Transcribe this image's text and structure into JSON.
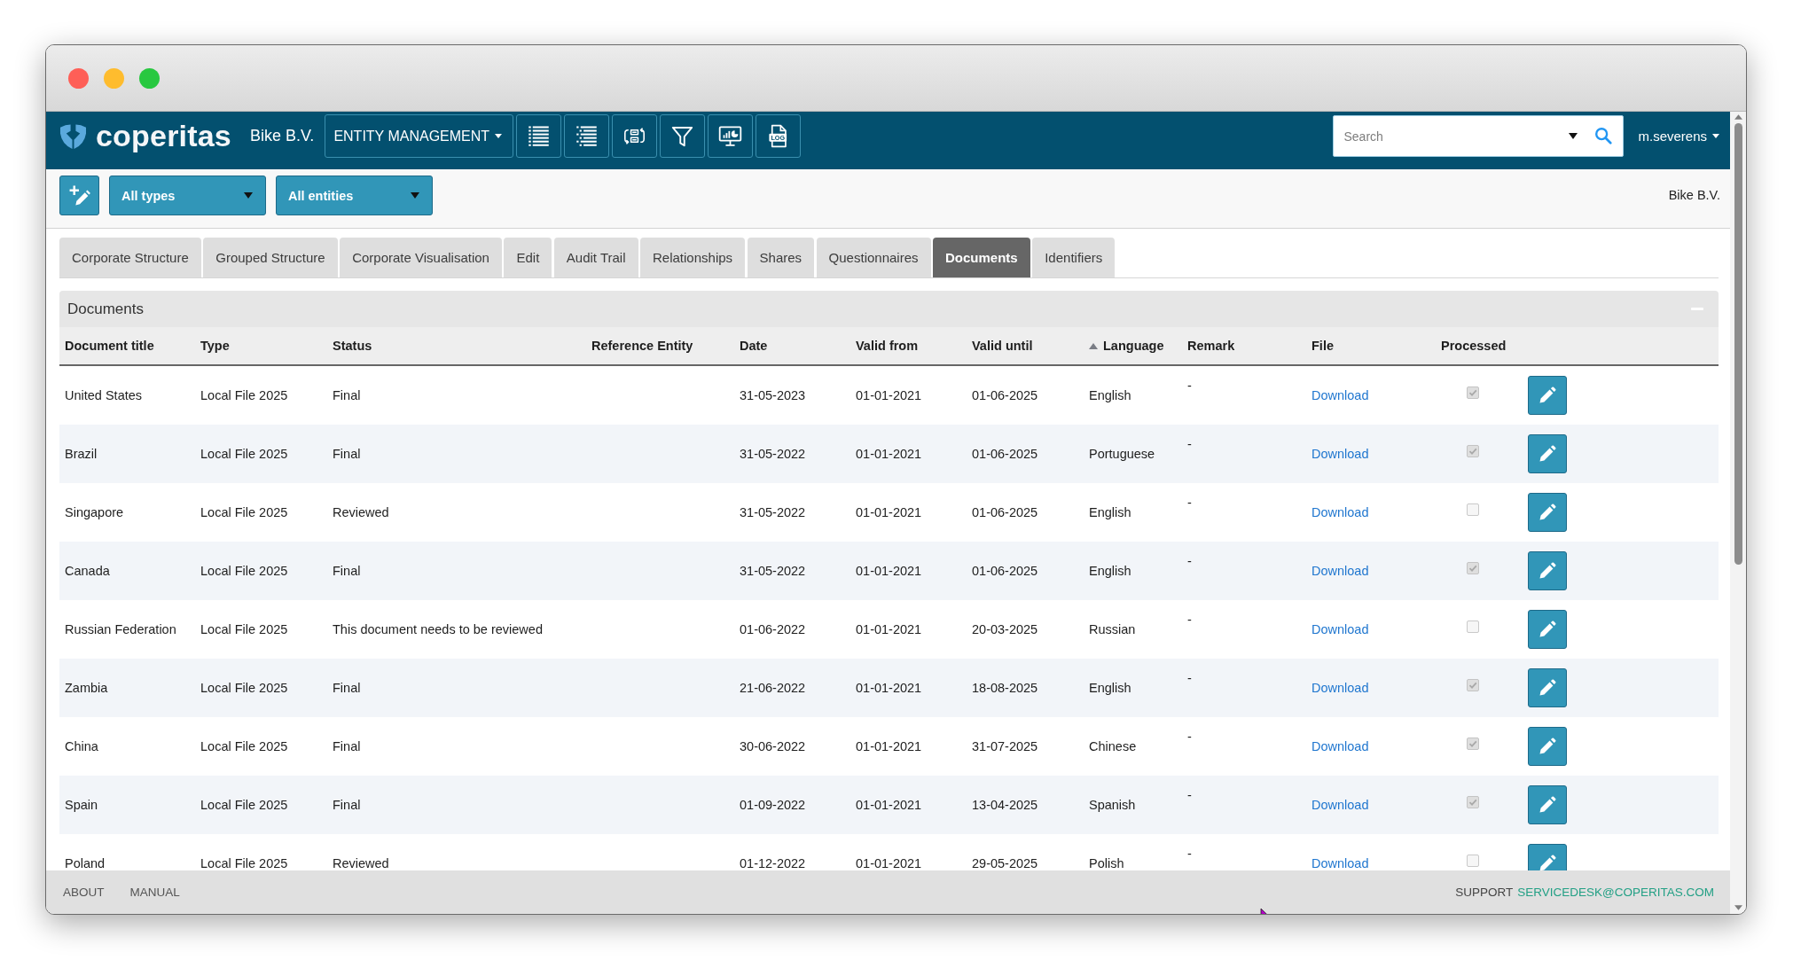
{
  "header": {
    "logo_text": "coperitas",
    "entity": "Bike B.V.",
    "module_menu": "ENTITY MANAGEMENT",
    "tool_buttons": [
      {
        "kind": "list"
      },
      {
        "kind": "indented_list"
      },
      {
        "kind": "swap"
      },
      {
        "kind": "filter"
      },
      {
        "kind": "monitor"
      },
      {
        "kind": "log",
        "label": "LOG"
      }
    ],
    "search": {
      "placeholder": "Search"
    },
    "user": "m.severens"
  },
  "toolbar": {
    "filters": [
      "All types",
      "All entities"
    ],
    "entity": "Bike B.V."
  },
  "tabs": [
    {
      "label": "Corporate Structure",
      "selected": false
    },
    {
      "label": "Grouped Structure",
      "selected": false
    },
    {
      "label": "Corporate Visualisation",
      "selected": false
    },
    {
      "label": "Edit",
      "selected": false
    },
    {
      "label": "Audit Trail",
      "selected": false
    },
    {
      "label": "Relationships",
      "selected": false
    },
    {
      "label": "Shares",
      "selected": false
    },
    {
      "label": "Questionnaires",
      "selected": false
    },
    {
      "label": "Documents",
      "selected": true
    },
    {
      "label": "Identifiers",
      "selected": false
    }
  ],
  "panel": {
    "title": "Documents",
    "columns": [
      {
        "label": "Document title",
        "sorted": false
      },
      {
        "label": "Type",
        "sorted": false
      },
      {
        "label": "Status",
        "sorted": false
      },
      {
        "label": "Reference Entity",
        "sorted": false
      },
      {
        "label": "Date",
        "sorted": false
      },
      {
        "label": "Valid from",
        "sorted": false
      },
      {
        "label": "Valid until",
        "sorted": false
      },
      {
        "label": "Language",
        "sorted": true
      },
      {
        "label": "Remark",
        "sorted": false
      },
      {
        "label": "File",
        "sorted": false
      },
      {
        "label": "Processed",
        "sorted": false
      }
    ],
    "rows": [
      {
        "title": "United States",
        "type": "Local File 2025",
        "status": "Final",
        "date": "31-05-2023",
        "valid_from": "01-01-2021",
        "valid_until": "01-06-2025",
        "language": "English",
        "remark": "-",
        "file": "Download",
        "processed": true
      },
      {
        "title": "Brazil",
        "type": "Local File 2025",
        "status": "Final",
        "date": "31-05-2022",
        "valid_from": "01-01-2021",
        "valid_until": "01-06-2025",
        "language": "Portuguese",
        "remark": "-",
        "file": "Download",
        "processed": true
      },
      {
        "title": "Singapore",
        "type": "Local File 2025",
        "status": "Reviewed",
        "date": "31-05-2022",
        "valid_from": "01-01-2021",
        "valid_until": "01-06-2025",
        "language": "English",
        "remark": "-",
        "file": "Download",
        "processed": false
      },
      {
        "title": "Canada",
        "type": "Local File 2025",
        "status": "Final",
        "date": "31-05-2022",
        "valid_from": "01-01-2021",
        "valid_until": "01-06-2025",
        "language": "English",
        "remark": "-",
        "file": "Download",
        "processed": true
      },
      {
        "title": "Russian Federation",
        "type": "Local File 2025",
        "status": "This document needs to be reviewed",
        "date": "01-06-2022",
        "valid_from": "01-01-2021",
        "valid_until": "20-03-2025",
        "language": "Russian",
        "remark": "-",
        "file": "Download",
        "processed": false
      },
      {
        "title": "Zambia",
        "type": "Local File 2025",
        "status": "Final",
        "date": "21-06-2022",
        "valid_from": "01-01-2021",
        "valid_until": "18-08-2025",
        "language": "English",
        "remark": "-",
        "file": "Download",
        "processed": true
      },
      {
        "title": "China",
        "type": "Local File 2025",
        "status": "Final",
        "date": "30-06-2022",
        "valid_from": "01-01-2021",
        "valid_until": "31-07-2025",
        "language": "Chinese",
        "remark": "-",
        "file": "Download",
        "processed": true
      },
      {
        "title": "Spain",
        "type": "Local File 2025",
        "status": "Final",
        "date": "01-09-2022",
        "valid_from": "01-01-2021",
        "valid_until": "13-04-2025",
        "language": "Spanish",
        "remark": "-",
        "file": "Download",
        "processed": true
      },
      {
        "title": "Poland",
        "type": "Local File 2025",
        "status": "Reviewed",
        "date": "01-12-2022",
        "valid_from": "01-01-2021",
        "valid_until": "29-05-2025",
        "language": "Polish",
        "remark": "-",
        "file": "Download",
        "processed": false
      }
    ]
  },
  "footer": {
    "links": [
      "ABOUT",
      "MANUAL"
    ],
    "support_label": "SUPPORT",
    "support_email": "SERVICEDESK@COPERITAS.COM"
  }
}
